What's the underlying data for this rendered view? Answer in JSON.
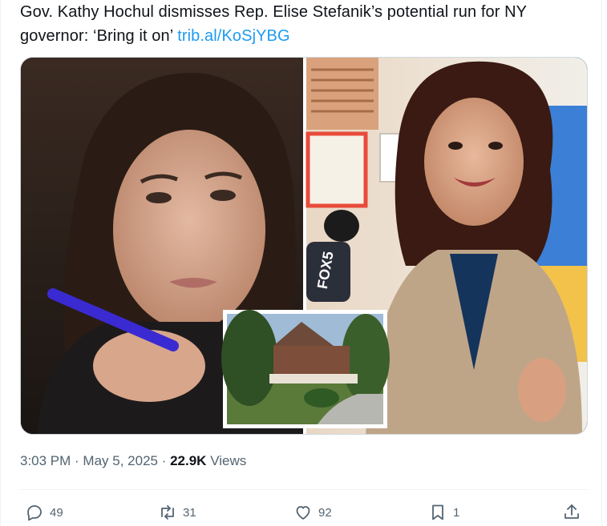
{
  "tweet": {
    "text": "Gov. Kathy Hochul dismisses Rep. Elise Stefanik’s potential run for NY governor: ‘Bring it on’ ",
    "link": "trib.al/KoSjYBG"
  },
  "meta": {
    "time": "3:03 PM",
    "separator1": " · ",
    "date": "May 5, 2025",
    "separator2": " · ",
    "views_count": "22.9K",
    "views_label": " Views"
  },
  "media": {
    "mic_label": "FOX5"
  },
  "actions": {
    "replies": "49",
    "reposts": "31",
    "likes": "92",
    "bookmarks": "1"
  },
  "icons": [
    "reply-icon",
    "repost-icon",
    "like-icon",
    "bookmark-icon",
    "share-icon"
  ],
  "colors": {
    "link": "#1d9bf0",
    "text": "#0f1419",
    "secondary": "#536471"
  }
}
